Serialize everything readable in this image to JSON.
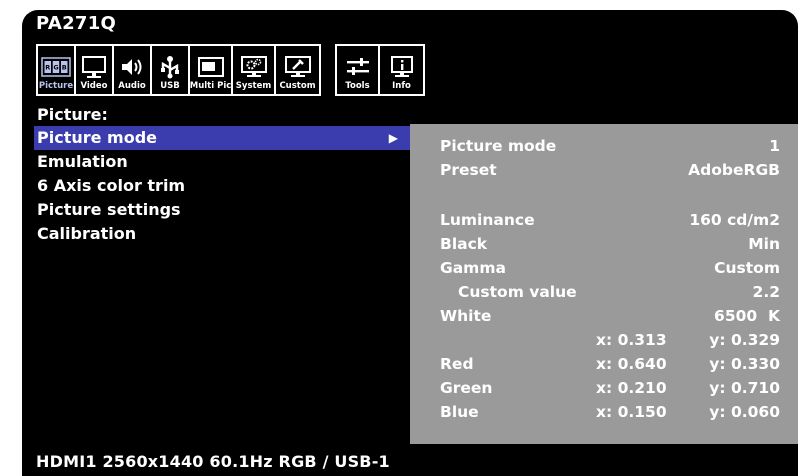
{
  "model": "PA271Q",
  "tabs_main": [
    {
      "label": "Picture",
      "icon": "picture-icon",
      "active": true
    },
    {
      "label": "Video",
      "icon": "video-icon"
    },
    {
      "label": "Audio",
      "icon": "audio-icon"
    },
    {
      "label": "USB",
      "icon": "usb-icon"
    },
    {
      "label": "Multi Pic",
      "icon": "multi-pic-icon"
    },
    {
      "label": "System",
      "icon": "system-icon"
    },
    {
      "label": "Custom",
      "icon": "custom-icon"
    }
  ],
  "tabs_extra": [
    {
      "label": "Tools",
      "icon": "tools-icon"
    },
    {
      "label": "Info",
      "icon": "info-icon"
    }
  ],
  "section_title": "Picture:",
  "menu": [
    {
      "label": "Picture mode",
      "selected": true,
      "arrow": "▶"
    },
    {
      "label": "Emulation"
    },
    {
      "label": "6 Axis color trim"
    },
    {
      "label": "Picture settings"
    },
    {
      "label": "Calibration"
    }
  ],
  "info": {
    "picture_mode": {
      "label": "Picture mode",
      "value": "1"
    },
    "preset": {
      "label": "Preset",
      "value": "AdobeRGB"
    },
    "luminance": {
      "label": "Luminance",
      "value": "160 cd/m2"
    },
    "black": {
      "label": "Black",
      "value": "Min"
    },
    "gamma": {
      "label": "Gamma",
      "value": "Custom"
    },
    "custom_value": {
      "label": "Custom value",
      "value": "2.2"
    },
    "white": {
      "label": "White",
      "value": "6500  K",
      "x": "x: 0.313",
      "y": "y: 0.329"
    },
    "red": {
      "label": "Red",
      "x": "x: 0.640",
      "y": "y: 0.330"
    },
    "green": {
      "label": "Green",
      "x": "x: 0.210",
      "y": "y: 0.710"
    },
    "blue": {
      "label": "Blue",
      "x": "x: 0.150",
      "y": "y: 0.060"
    }
  },
  "status": "HDMI1 2560x1440 60.1Hz RGB / USB-1",
  "colors": {
    "selection": "#3b3cae",
    "panel": "#9a9a9a",
    "active_tab_label": "#b8c2ec"
  }
}
